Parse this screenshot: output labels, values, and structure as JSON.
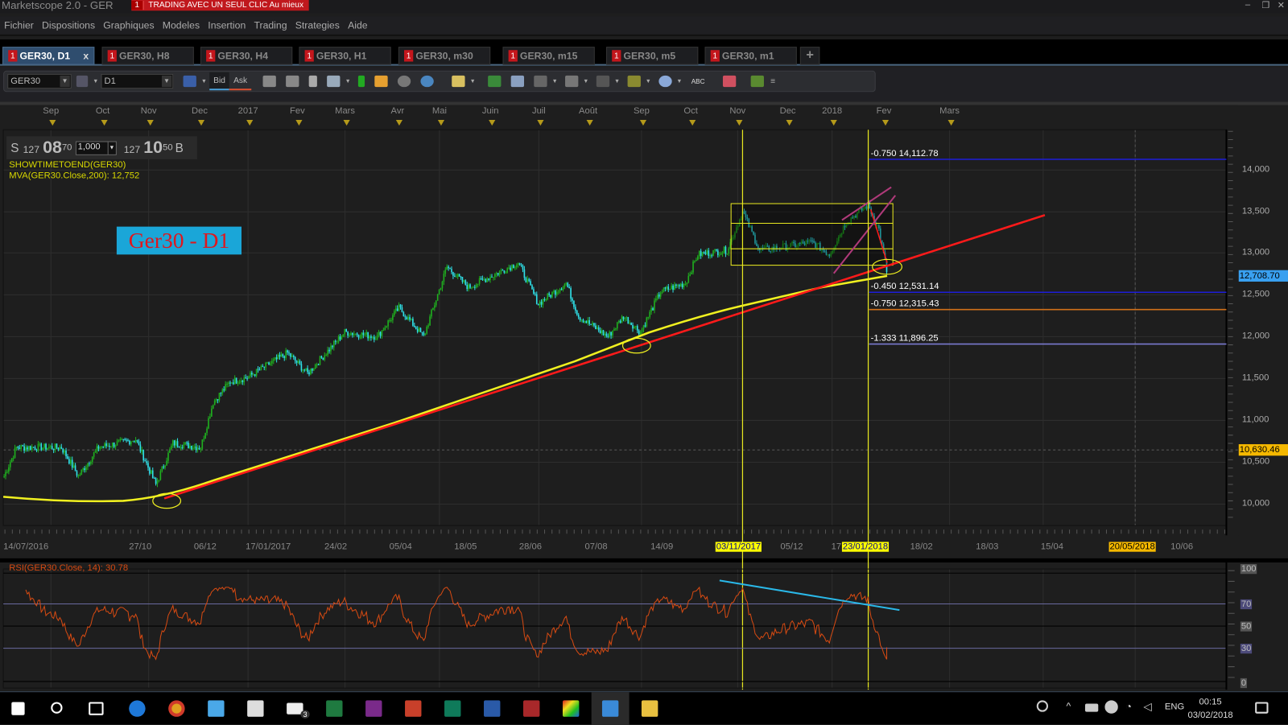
{
  "window": {
    "title": "Marketscope 2.0 - GER",
    "promo_badge": "1",
    "promo_text": "TRADING AVEC UN SEUL CLIC Au mieux",
    "minimize": "–",
    "restore": "❐",
    "close": "✕"
  },
  "menu": [
    "Fichier",
    "Dispositions",
    "Graphiques",
    "Modeles",
    "Insertion",
    "Trading",
    "Strategies",
    "Aide"
  ],
  "tabs": [
    {
      "badge": "1",
      "label": "GER30, D1",
      "active": true,
      "close": "x"
    },
    {
      "badge": "1",
      "label": "GER30, H8"
    },
    {
      "badge": "1",
      "label": "GER30, H4"
    },
    {
      "badge": "1",
      "label": "GER30, H1"
    },
    {
      "badge": "1",
      "label": "GER30, m30"
    },
    {
      "badge": "1",
      "label": "GER30, m15"
    },
    {
      "badge": "1",
      "label": "GER30, m5"
    },
    {
      "badge": "1",
      "label": "GER30, m1"
    }
  ],
  "add_tab": "+",
  "toolbar": {
    "instrument": "GER30",
    "timeframe": "D1",
    "bid": "Bid",
    "ask": "Ask",
    "abc": "ABC"
  },
  "quote": {
    "side_sell": "S",
    "sell_small": "127",
    "sell_big": "08",
    "sell_sup": "70",
    "quantity": "1,000",
    "buy_small": "127",
    "buy_big": "10",
    "buy_sup": "50",
    "side_buy": "B"
  },
  "indicators": {
    "line1": "SHOWTIMETOEND(GER30)",
    "line2": "MVA(GER30.Close,200): 12,752",
    "rsi": "RSI(GER30.Close, 14): 30.78"
  },
  "annotation": "Ger30 - D1",
  "top_axis": [
    "Sep",
    "Oct",
    "Nov",
    "Dec",
    "2017",
    "Fev",
    "Mars",
    "Avr",
    "Mai",
    "Juin",
    "Juil",
    "Août",
    "Sep",
    "Oct",
    "Nov",
    "Dec",
    "2018",
    "Fev",
    "Mars"
  ],
  "price_axis": [
    "14,000",
    "13,500",
    "13,000",
    "12,500",
    "12,000",
    "11,500",
    "11,000",
    "10,500",
    "10,000"
  ],
  "price_tags": {
    "current": "12,708.70",
    "marker": "10,630.46"
  },
  "fib_levels": [
    {
      "label": "-0.750 14,112.78",
      "color": "#1d1dd8"
    },
    {
      "label": "-0.450 12,531.14",
      "color": "#1d1dd8"
    },
    {
      "label": "-0.750 12,315.43",
      "color": "#d0701a"
    },
    {
      "label": "-1.333 11,896.25",
      "color": "#7a7ad0"
    }
  ],
  "date_axis": [
    "14/07/2016",
    "27/10",
    "06/12",
    "17/01/2017",
    "24/02",
    "05/04",
    "18/05",
    "28/06",
    "07/08",
    "14/09",
    "03/11/2017",
    "05/12",
    "17",
    "23/01/2018",
    "18/02",
    "18/03",
    "15/04",
    "20/05/2018",
    "10/06"
  ],
  "rsi_axis": [
    "100",
    "70",
    "50",
    "30",
    "0"
  ],
  "colors": {
    "up": "#1fae1f",
    "down": "#2fe0e8",
    "mva": "#f0f020",
    "trend": "#ff1a1a",
    "channel": "#b03a7a",
    "rsi": "#d64a12",
    "rsi_trend": "#2ab8e8"
  },
  "chart_data": {
    "type": "line",
    "title": "GER30, D1",
    "x_unit": "days since 14/07/2016",
    "price_keypoints": [
      [
        0,
        10335
      ],
      [
        8,
        10680
      ],
      [
        37,
        10680
      ],
      [
        48,
        10335
      ],
      [
        61,
        10680
      ],
      [
        85,
        10775
      ],
      [
        98,
        10235
      ],
      [
        109,
        10730
      ],
      [
        127,
        10680
      ],
      [
        135,
        11220
      ],
      [
        146,
        11465
      ],
      [
        157,
        11515
      ],
      [
        183,
        11810
      ],
      [
        196,
        11565
      ],
      [
        220,
        12060
      ],
      [
        241,
        12005
      ],
      [
        255,
        12350
      ],
      [
        271,
        12005
      ],
      [
        286,
        12840
      ],
      [
        300,
        12595
      ],
      [
        332,
        12890
      ],
      [
        345,
        12400
      ],
      [
        363,
        12645
      ],
      [
        371,
        12250
      ],
      [
        390,
        12005
      ],
      [
        400,
        12250
      ],
      [
        411,
        12060
      ],
      [
        424,
        12545
      ],
      [
        440,
        12645
      ],
      [
        448,
        12990
      ],
      [
        467,
        13040
      ],
      [
        477,
        13500
      ],
      [
        488,
        13040
      ],
      [
        507,
        13090
      ],
      [
        522,
        13135
      ],
      [
        533,
        12990
      ],
      [
        544,
        13380
      ],
      [
        558,
        13580
      ],
      [
        565,
        13285
      ],
      [
        570,
        12790
      ]
    ],
    "ylim": [
      9650,
      14400
    ],
    "rsi_ylim": [
      0,
      100
    ]
  },
  "taskbar": {
    "lang": "ENG",
    "time": "00:15",
    "date": "03/02/2018",
    "mail_badge": "3"
  }
}
